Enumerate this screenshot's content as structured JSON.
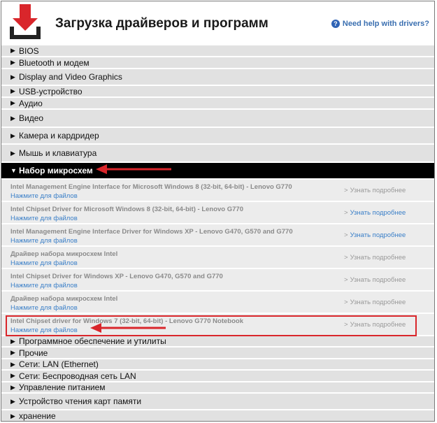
{
  "header": {
    "title": "Загрузка драйверов и программ",
    "help_icon": "question-icon",
    "help_label": "Need help with drivers?"
  },
  "categories_top": [
    {
      "label": "BIOS"
    },
    {
      "label": "Bluetooth и модем"
    },
    {
      "label": "Display and Video Graphics"
    },
    {
      "label": "USB-устройство"
    },
    {
      "label": "Аудио"
    },
    {
      "label": "Видео"
    },
    {
      "label": "Камера и кардридер"
    },
    {
      "label": "Мышь и клавиатура"
    }
  ],
  "open_category": {
    "label": "Набор микросхем"
  },
  "items": [
    {
      "name": "Intel Management Engine Interface for Microsoft Windows 8 (32-bit, 64-bit) - Lenovo G770",
      "files": "Нажмите для файлов",
      "more": "Узнать подробнее"
    },
    {
      "name": "Intel Chipset Driver for Microsoft Windows 8 (32-bit, 64-bit) - Lenovo G770",
      "files": "Нажмите для файлов",
      "more": "Узнать подробнее"
    },
    {
      "name": "Intel Management Engine Interface Driver for Windows XP - Lenovo G470, G570 and G770",
      "files": "Нажмите для файлов",
      "more": "Узнать подробнее"
    },
    {
      "name": "Драйвер набора микросхем Intel",
      "files": "Нажмите для файлов",
      "more": "Узнать подробнее"
    },
    {
      "name": "Intel Chipset Driver for Windows XP - Lenovo G470, G570 and G770",
      "files": "Нажмите для файлов",
      "more": "Узнать подробнее"
    },
    {
      "name": "Драйвер набора микросхем Intel",
      "files": "Нажмите для файлов",
      "more": "Узнать подробнее"
    },
    {
      "name": "Intel Chipset driver for Windows 7 (32-bit, 64-bit) - Lenovo G770 Notebook",
      "files": "Нажмите для файлов",
      "more": "Узнать подробнее"
    }
  ],
  "categories_bottom": [
    {
      "label": "Программное обеспечение и утилиты"
    },
    {
      "label": "Прочие"
    },
    {
      "label": "Сети: LAN (Ethernet)"
    },
    {
      "label": "Сети: Беспроводная сеть LAN"
    },
    {
      "label": "Управление питанием"
    },
    {
      "label": "Устройство чтения карт памяти"
    },
    {
      "label": "хранение"
    }
  ],
  "colors": {
    "accent_link": "#3a7fc8",
    "annotation_red": "#d9262b",
    "open_bar": "#000000"
  }
}
